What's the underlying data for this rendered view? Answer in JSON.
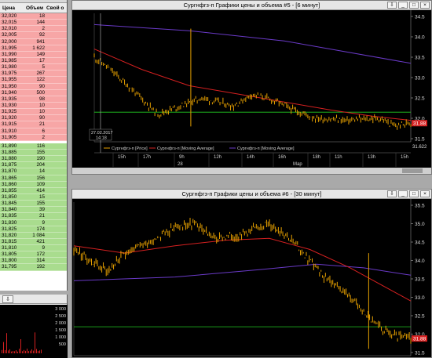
{
  "order_book": {
    "headers": [
      "Цена",
      "Объем",
      "Свой о"
    ],
    "asks": [
      [
        "32,020",
        "18"
      ],
      [
        "32,015",
        "144"
      ],
      [
        "32,010",
        "2"
      ],
      [
        "32,005",
        "92"
      ],
      [
        "32,000",
        "941"
      ],
      [
        "31,995",
        "1 622"
      ],
      [
        "31,990",
        "149"
      ],
      [
        "31,985",
        "17"
      ],
      [
        "31,980",
        "5"
      ],
      [
        "31,975",
        "267"
      ],
      [
        "31,955",
        "122"
      ],
      [
        "31,950",
        "90"
      ],
      [
        "31,940",
        "500"
      ],
      [
        "31,935",
        "98"
      ],
      [
        "31,930",
        "10"
      ],
      [
        "31,925",
        "10"
      ],
      [
        "31,920",
        "90"
      ],
      [
        "31,915",
        "21"
      ],
      [
        "31,910",
        "6"
      ],
      [
        "31,905",
        "2"
      ]
    ],
    "bids": [
      [
        "31,890",
        "116"
      ],
      [
        "31,885",
        "155"
      ],
      [
        "31,880",
        "190"
      ],
      [
        "31,875",
        "204"
      ],
      [
        "31,870",
        "14"
      ],
      [
        "31,865",
        "156"
      ],
      [
        "31,860",
        "109"
      ],
      [
        "31,855",
        "414"
      ],
      [
        "31,850",
        "15"
      ],
      [
        "31,845",
        "155"
      ],
      [
        "31,840",
        "39"
      ],
      [
        "31,835",
        "21"
      ],
      [
        "31,830",
        "9"
      ],
      [
        "31,825",
        "174"
      ],
      [
        "31,820",
        "1 084"
      ],
      [
        "31,815",
        "421"
      ],
      [
        "31,810",
        "9"
      ],
      [
        "31,805",
        "172"
      ],
      [
        "31,800",
        "314"
      ],
      [
        "31,795",
        "192"
      ]
    ]
  },
  "mini_chart": {
    "toolbar_icon": "pin-icon",
    "axis_labels": [
      "3 000",
      "2 500",
      "2 000",
      "1 500",
      "1 000",
      "500"
    ],
    "last_value": "0"
  },
  "chart1": {
    "title": "Сургнфгз-п Графики цены и объема #5 - [6 минут]",
    "y_ticks": [
      "34.5",
      "34.0",
      "33.5",
      "33.0",
      "32.5",
      "32.0",
      "31.5"
    ],
    "price_label": "31.88",
    "bottom_label": "31.622",
    "crosshair_date": "27.02.2017",
    "crosshair_time": "14:18",
    "legend": [
      "Сургнфгз-п [Price]",
      "Сургнфгз-п [Moving Average]",
      "Сургнфгз-п [Moving Average]"
    ],
    "x_ticks": [
      "15h",
      "17h",
      "9h",
      "12h",
      "14h",
      "16h",
      "18h",
      "11h",
      "13h",
      "15h"
    ],
    "date_labels": [
      "28",
      "Мар"
    ],
    "colors": {
      "price": "#e6a000",
      "ma_short": "#d62020",
      "ma_long": "#6a3ac8",
      "level": "#22cc22"
    }
  },
  "chart2": {
    "title": "Сургнфгз-п Графики цены и объема #6 - [30 минут]",
    "y_ticks": [
      "35.5",
      "35.0",
      "34.5",
      "34.0",
      "33.5",
      "33.0",
      "32.5",
      "32.0",
      "31.5"
    ],
    "price_label": "31.88",
    "colors": {
      "price": "#e6a000",
      "ma_short": "#d62020",
      "ma_long": "#6a3ac8",
      "level": "#22cc22"
    }
  },
  "window_buttons": {
    "pin": "⇩",
    "minimize": "_",
    "maximize": "□",
    "close": "×"
  }
}
